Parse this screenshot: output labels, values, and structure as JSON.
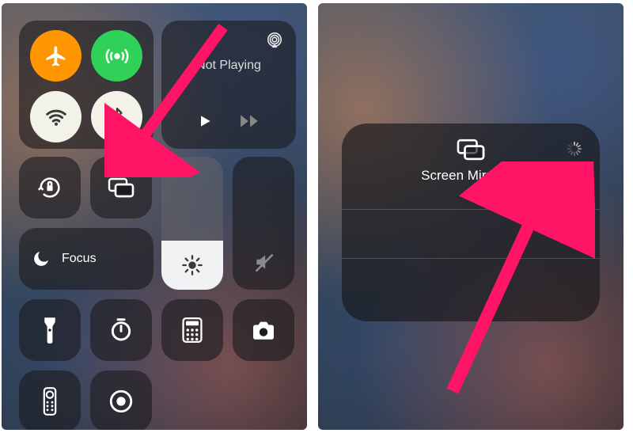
{
  "left": {
    "media": {
      "status": "Not Playing"
    },
    "focus": {
      "label": "Focus"
    },
    "icons": {
      "airplane": "airplane-icon",
      "antenna": "cellular-antenna-icon",
      "wifi": "wifi-icon",
      "bluetooth": "bluetooth-icon",
      "airplay_audio": "airplay-audio-icon",
      "play": "play-icon",
      "forward": "forward-icon",
      "lock_rotation": "rotation-lock-icon",
      "screen_mirror": "screen-mirroring-icon",
      "moon": "moon-icon",
      "brightness": "brightness-icon",
      "volume_mute": "volume-mute-icon",
      "flashlight": "flashlight-icon",
      "timer": "timer-icon",
      "calculator": "calculator-icon",
      "camera": "camera-icon",
      "remote": "apple-tv-remote-icon",
      "record": "screen-record-icon"
    }
  },
  "right": {
    "mirroring": {
      "title": "Screen Mirroring",
      "icon": "screen-mirroring-icon",
      "spinner": "loading-spinner-icon"
    }
  },
  "annotation": {
    "arrow_color": "#ff1466"
  }
}
